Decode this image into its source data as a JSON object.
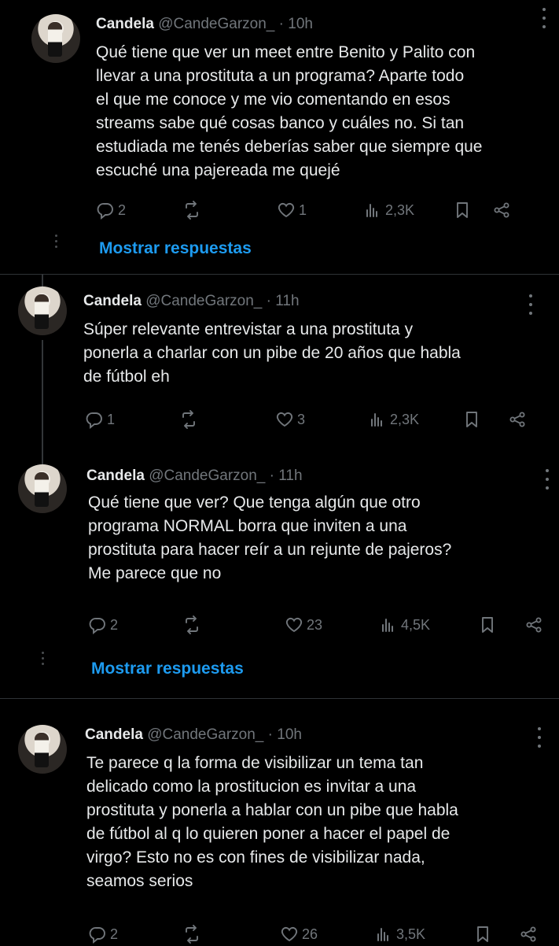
{
  "tweets": [
    {
      "name": "Candela",
      "handle": "@CandeGarzon_",
      "dot": "·",
      "time": "10h",
      "lines": [
        "Qué tiene que ver un meet entre Benito y Palito con",
        "llevar a una prostituta a un programa? Aparte todo",
        "el que me conoce y me vio comentando en esos",
        "streams sabe qué cosas banco y cuáles no. Si tan",
        "estudiada me tenés deberías saber que siempre que",
        "escuché una pajereada me quejé"
      ],
      "replies": "2",
      "retweets": "",
      "likes": "1",
      "views": "2,3K",
      "show_replies": "Mostrar respuestas"
    },
    {
      "name": "Candela",
      "handle": "@CandeGarzon_",
      "dot": "·",
      "time": "11h",
      "lines": [
        "Súper relevante entrevistar a una prostituta y",
        "ponerla a charlar con un pibe de 20 años que habla",
        "de fútbol eh"
      ],
      "replies": "1",
      "retweets": "",
      "likes": "3",
      "views": "2,3K"
    },
    {
      "name": "Candela",
      "handle": "@CandeGarzon_",
      "dot": "·",
      "time": "11h",
      "lines": [
        "Qué tiene que ver? Que tenga algún que otro",
        "programa NORMAL borra que inviten a una",
        "prostituta para hacer reír a un rejunte de pajeros?",
        "Me parece que no"
      ],
      "replies": "2",
      "retweets": "",
      "likes": "23",
      "views": "4,5K",
      "show_replies": "Mostrar respuestas"
    },
    {
      "name": "Candela",
      "handle": "@CandeGarzon_",
      "dot": "·",
      "time": "10h",
      "lines": [
        "Te parece q la forma de visibilizar un tema tan",
        "delicado como la prostitucion es invitar a una",
        "prostituta y ponerla a hablar con un pibe que habla",
        "de fútbol al q lo quieren poner a hacer el papel de",
        "virgo? Esto no es con fines de visibilizar nada,",
        "seamos serios"
      ],
      "replies": "2",
      "retweets": "",
      "likes": "26",
      "views": "3,5K"
    }
  ],
  "icons": {
    "reply": "reply-icon",
    "retweet": "retweet-icon",
    "like": "heart-icon",
    "views": "views-icon",
    "bookmark": "bookmark-icon",
    "share": "share-icon",
    "more": "more-icon"
  },
  "colors": {
    "background": "#000000",
    "text": "#e7e9ea",
    "muted": "#71767b",
    "link": "#1d9bf0"
  }
}
